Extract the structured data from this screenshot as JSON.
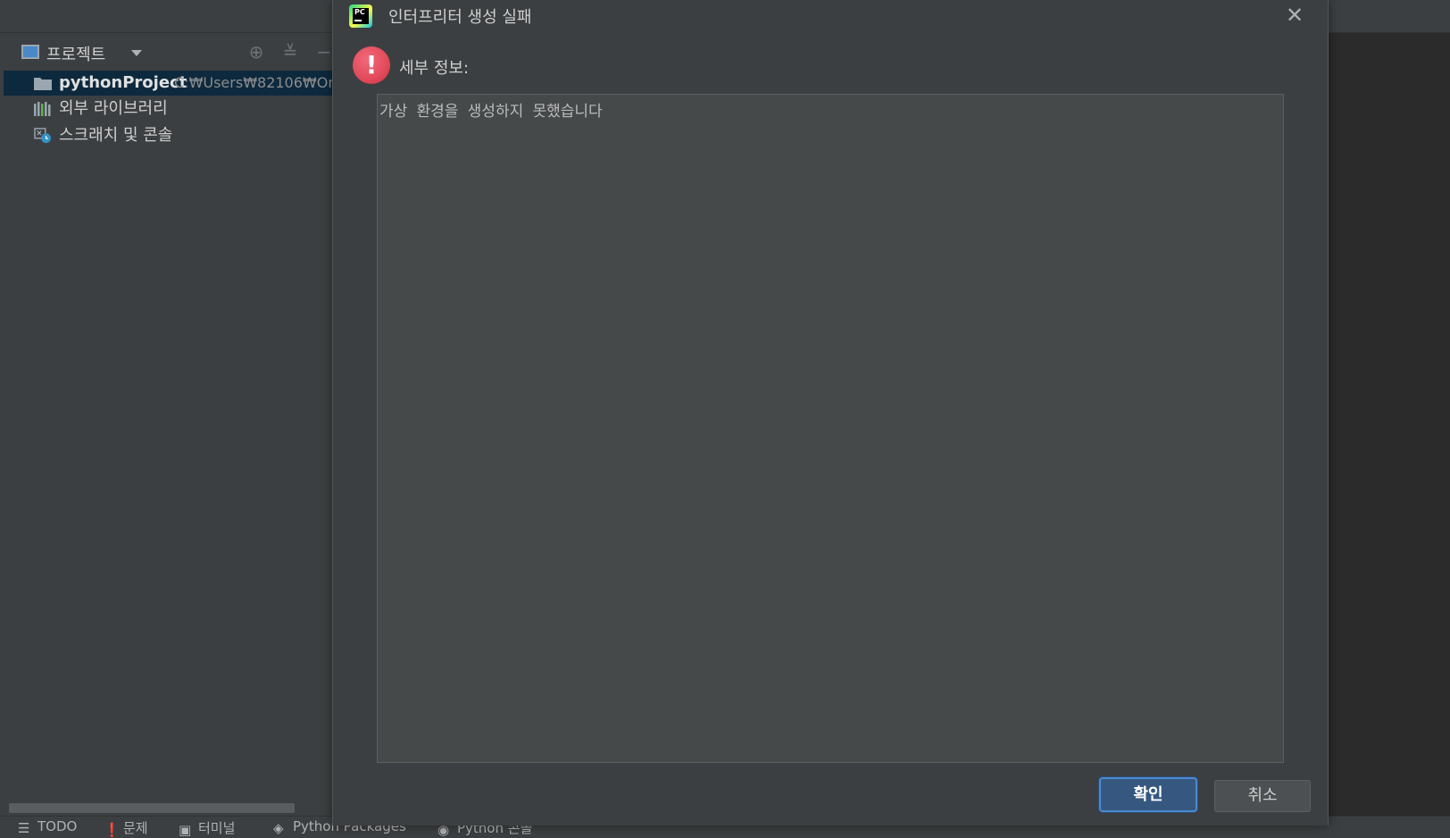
{
  "project_panel": {
    "title": "프로젝트",
    "tree": [
      {
        "label": "pythonProject",
        "path": "C:₩Users₩82106₩On",
        "icon": "folder-icon"
      },
      {
        "label": "외부 라이브러리",
        "icon": "library-icon"
      },
      {
        "label": "스크래치 및 콘솔",
        "icon": "scratch-icon"
      }
    ]
  },
  "statusbar": {
    "items": [
      {
        "label": "TODO",
        "icon": "list-icon"
      },
      {
        "label": "문제",
        "icon": "problems-icon"
      },
      {
        "label": "터미널",
        "icon": "terminal-icon"
      },
      {
        "label": "Python Packages",
        "icon": "packages-icon"
      },
      {
        "label": "Python 콘솔",
        "icon": "python-icon"
      }
    ]
  },
  "dialog": {
    "title": "인터프리터 생성 실패",
    "detail_label": "세부 정보:",
    "detail_text": "가상 환경을 생성하지 못했습니다",
    "ok_label": "확인",
    "cancel_label": "취소",
    "logo_text": "PC"
  },
  "colors": {
    "ok_button": "#365880",
    "error_icon": "#e24a5a",
    "selection": "#0d293e"
  }
}
